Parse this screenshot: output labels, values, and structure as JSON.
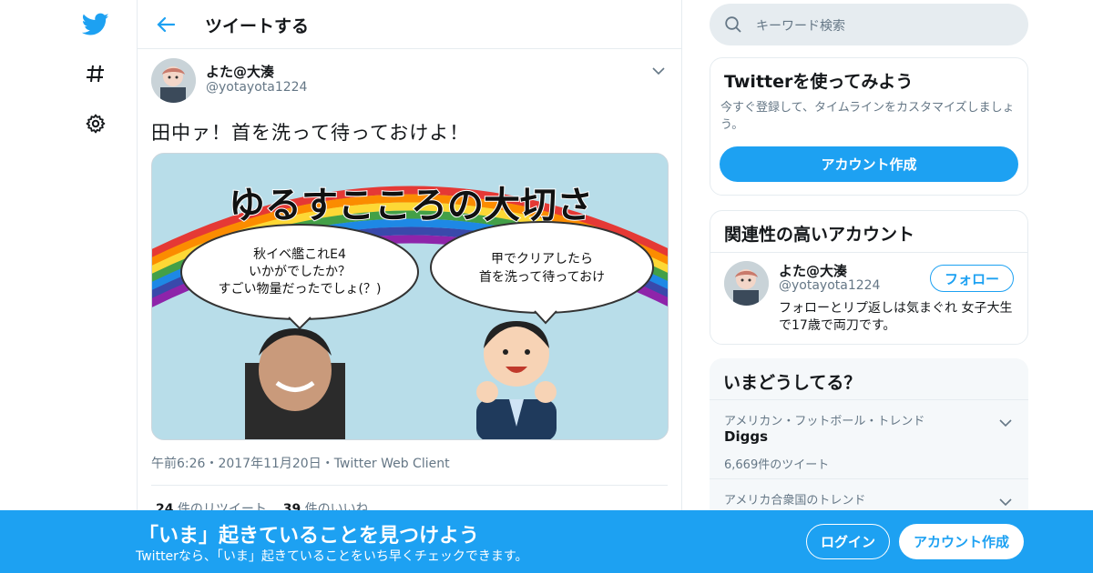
{
  "nav": {
    "icons": [
      "twitter-bird-icon",
      "hashtag-icon",
      "gear-icon"
    ]
  },
  "header": {
    "title": "ツイートする"
  },
  "tweet": {
    "author_name": "よた@大湊",
    "author_handle": "@yotayota1224",
    "text": "田中ァ！首を洗って待っておけよ！",
    "media": {
      "title": "ゆるすこころの大切さ",
      "bubble_left": [
        "秋イベ艦これE4",
        "いかがでしたか？",
        "すごい物量だったでしょ(？)"
      ],
      "bubble_right": [
        "甲でクリアしたら",
        "首を洗って待っておけ"
      ]
    },
    "timestamp": "午前6:26・2017年11月20日・Twitter Web Client",
    "retweet_count": "24",
    "retweet_label": " 件のリツイート",
    "like_count": "39",
    "like_label": " 件のいいね"
  },
  "search": {
    "placeholder": "キーワード検索"
  },
  "signup_card": {
    "title": "Twitterを使ってみよう",
    "desc": "今すぐ登録して、タイムラインをカスタマイズしましょう。",
    "button": "アカウント作成"
  },
  "related": {
    "title": "関連性の高いアカウント",
    "name": "よた@大湊",
    "handle": "@yotayota1224",
    "follow": "フォロー",
    "bio": "フォローとリプ返しは気まぐれ 女子大生で17歳で両刀です。"
  },
  "trends": {
    "title": "いまどうしてる？",
    "items": [
      {
        "context": "アメリカン・フットボール・トレンド",
        "name": "Diggs",
        "count": "6,669件のツイート"
      },
      {
        "context": "アメリカ合衆国のトレンド"
      }
    ]
  },
  "banner": {
    "title": "「いま」起きていることを見つけよう",
    "subtitle": "Twitterなら、「いま」起きていることをいち早くチェックできます。",
    "login": "ログイン",
    "signup": "アカウント作成"
  },
  "colors": {
    "brand": "#1da1f2",
    "text": "#14171a",
    "secondary": "#657786",
    "border": "#e6ecf0"
  }
}
